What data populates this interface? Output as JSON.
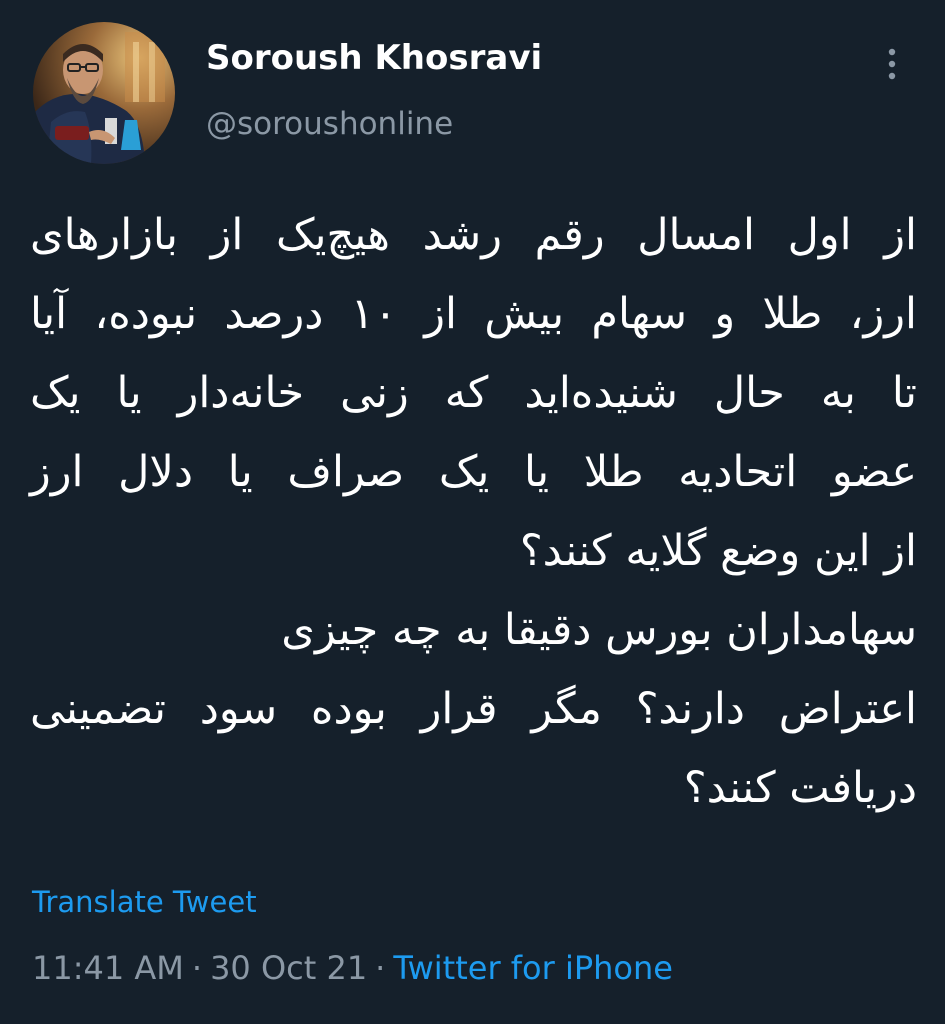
{
  "colors": {
    "background": "#15202b",
    "primary_text": "#ffffff",
    "secondary_text": "#8b98a5",
    "link": "#1d9bf0"
  },
  "author": {
    "display_name": "Soroush Khosravi",
    "handle": "@soroushonline",
    "avatar_icon": "profile-photo"
  },
  "header": {
    "more_icon": "vertical-ellipsis-icon"
  },
  "tweet": {
    "lines": [
      "از اول امسال رقم رشد هیچ‌یک از بازارهای",
      "ارز، طلا و سهام بیش از ۱۰ درصد نبوده، آیا",
      "تا به حال شنیده‌اید که زنی خانه‌دار یا یک",
      "عضو اتحادیه طلا یا یک صراف یا دلال ارز",
      "از این وضع گلایه کنند؟",
      "سهامداران بورس دقیقا به چه چیزی",
      "اعتراض دارند؟ مگر قرار بوده سود تضمینی",
      "دریافت کنند؟"
    ]
  },
  "translate_label": "Translate Tweet",
  "meta": {
    "time": "11:41 AM",
    "separator": "·",
    "date": "30 Oct 21",
    "source": "Twitter for iPhone"
  }
}
